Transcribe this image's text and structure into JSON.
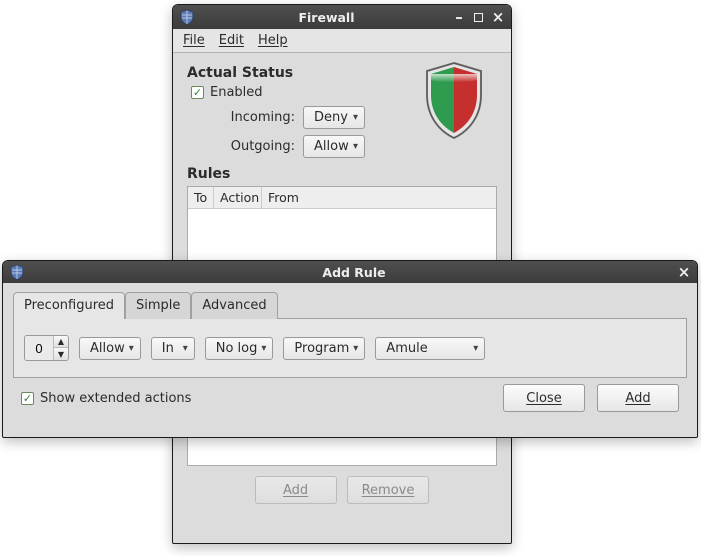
{
  "firewall_window": {
    "title": "Firewall",
    "menubar": {
      "file": "File",
      "edit": "Edit",
      "help": "Help"
    },
    "status_section_title": "Actual Status",
    "enabled_label": "Enabled",
    "incoming_label": "Incoming:",
    "incoming_value": "Deny",
    "outgoing_label": "Outgoing:",
    "outgoing_value": "Allow",
    "rules_title": "Rules",
    "columns": {
      "to": "To",
      "action": "Action",
      "from": "From"
    },
    "buttons": {
      "add": "Add",
      "remove": "Remove"
    }
  },
  "add_rule_dialog": {
    "title": "Add Rule",
    "tabs": {
      "preconfigured": "Preconfigured",
      "simple": "Simple",
      "advanced": "Advanced"
    },
    "spinner_value": "0",
    "policy": "Allow",
    "direction": "In",
    "log": "No log",
    "kind": "Program",
    "program": "Amule",
    "show_extended_label": "Show extended actions",
    "buttons": {
      "close": "Close",
      "add": "Add"
    }
  }
}
